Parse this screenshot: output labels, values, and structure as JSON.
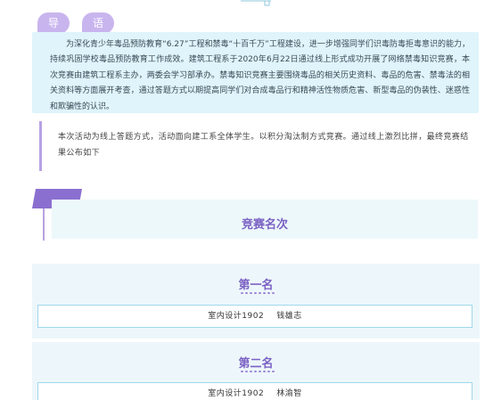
{
  "intro_tags": [
    "导",
    "语"
  ],
  "intro_text": "为深化青少年毒品预防教育“6.27”工程和禁毒“十百千万”工程建设，进一步增强同学们识毒防毒拒毒意识的能力，持续巩固学校毒品预防教育工作成效。建筑工程系于2020年6月22日通过线上形式成功开展了网络禁毒知识竞赛，本次竞赛由建筑工程系主办，两委会学习部承办。禁毒知识竞赛主要围绕毒品的相关历史资料、毒品的危害、禁毒法的相关资料等方面展开考查，通过答题方式以期提高同学们对合成毒品行和精神活性物质危害、新型毒品的伪装性、迷惑性和欺骗性的认识。",
  "notice_text": "本次活动为线上答题方式，活动面向建工系全体学生。以积分淘汰制方式竞赛。通过线上激烈比拼，最终竞赛结果公布如下",
  "section_title": "竞赛名次",
  "rankings": [
    {
      "title": "第一名",
      "class": "室内设计1902",
      "name": "钱雄志"
    },
    {
      "title": "第二名",
      "class": "室内设计1902",
      "name": "林渝智"
    }
  ],
  "colors": {
    "accent_purple": "#7b61c4",
    "tag_purple": "#c9b5ee",
    "panel_blue": "#dff4fb",
    "border_blue": "#9fd7ec"
  }
}
